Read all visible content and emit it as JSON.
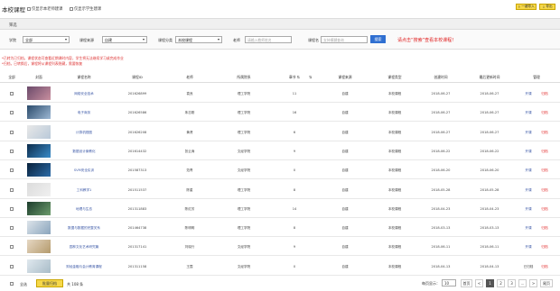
{
  "header": {
    "title": "本校课程",
    "options": [
      "仅显示本老师建课",
      "仅显示学生建课"
    ],
    "import_label": "一键导入",
    "export_label": "导出"
  },
  "filter": {
    "panel_title": "筛选",
    "school_label": "学院",
    "school_value": "全部",
    "source_label": "课程来源",
    "source_value": "自建",
    "category_label": "课程分类",
    "category_value": "本校课程",
    "teacher_label": "老师",
    "teacher_placeholder": "请输入教师姓名",
    "course_label": "课程名",
    "course_placeholder": "支持模糊查询",
    "search_label": "搜索",
    "hint": "请点击“搜索”查看本校课程！"
  },
  "notices": [
    "*已转为已归档，课程状态可查看近期课时内容，学生将无法继续学习或完成作业",
    "*归档，已转换后，课程将从课程列表隐藏，需要恢复"
  ],
  "table": {
    "columns": [
      "全部",
      "封面",
      "课程名称",
      "课程ID",
      "老师",
      "所属院系",
      "章节",
      "人数",
      "课程来源",
      "课程类型",
      "创建时间",
      "最后更新时间",
      "管理"
    ],
    "rows": [
      {
        "name": "网络安全技术",
        "id": "201626899",
        "teacher": "袁良",
        "dept": "理工学院",
        "chapters": "11",
        "source": "自建",
        "type": "本校课程",
        "created": "2018-06-27",
        "updated": "2018-06-27",
        "action1": "开课",
        "action2": "归档",
        "cover": [
          "#6a4a6a",
          "#c98f9f"
        ]
      },
      {
        "name": "电子商务",
        "id": "201626586",
        "teacher": "朱志刚",
        "dept": "理工学院",
        "chapters": "16",
        "source": "自建",
        "type": "本校课程",
        "created": "2018-06-27",
        "updated": "2018-06-27",
        "action1": "开课",
        "action2": "归档",
        "cover": [
          "#2a4a6a",
          "#9db8d4"
        ]
      },
      {
        "name": "计算机视图",
        "id": "201626208",
        "teacher": "黄贤",
        "dept": "理工学院",
        "chapters": "6",
        "source": "自建",
        "type": "本校课程",
        "created": "2018-06-27",
        "updated": "2018-06-27",
        "action1": "开课",
        "action2": "归档",
        "cover": [
          "#e8e8e8",
          "#b9c9d9"
        ]
      },
      {
        "name": "数据设计案教化",
        "id": "201614432",
        "teacher": "张云涛",
        "dept": "文经学院",
        "chapters": "9",
        "source": "自建",
        "type": "本校课程",
        "created": "2018-06-22",
        "updated": "2018-06-22",
        "action1": "开课",
        "action2": "归档",
        "cover": [
          "#0c2c4c",
          "#3a8bc8"
        ]
      },
      {
        "name": "SVM安全实训",
        "id": "201587313",
        "teacher": "范青",
        "dept": "文经学院",
        "chapters": "0",
        "source": "自建",
        "type": "本校课程",
        "created": "2018-06-20",
        "updated": "2018-06-20",
        "action1": "开课",
        "action2": "归档",
        "cover": [
          "#08203a",
          "#2c6ca8"
        ]
      },
      {
        "name": "工科教学1",
        "id": "201511537",
        "teacher": "陈星",
        "dept": "理工学院",
        "chapters": "8",
        "source": "自建",
        "type": "本校课程",
        "created": "2018-05-28",
        "updated": "2018-05-28",
        "action1": "开课",
        "action2": "归档",
        "cover": [
          "#dcdcdc",
          "#f0f0f0"
        ]
      },
      {
        "name": "地理与生态",
        "id": "201311883",
        "teacher": "陈红芳",
        "dept": "理工学院",
        "chapters": "14",
        "source": "自建",
        "type": "本校课程",
        "created": "2018-04-23",
        "updated": "2018-04-23",
        "action1": "开课",
        "action2": "归档",
        "cover": [
          "#1c3c2c",
          "#6c9c6c"
        ]
      },
      {
        "name": "数据与数据的完整关系",
        "id": "201464738",
        "teacher": "陈明明",
        "dept": "理工学院",
        "chapters": "8",
        "source": "自建",
        "type": "本校课程",
        "created": "2018-03-13",
        "updated": "2018-03-13",
        "action1": "开课",
        "action2": "归档",
        "cover": [
          "#dde4ea",
          "#8aa4bc"
        ]
      },
      {
        "name": "园林文化艺术研究篇",
        "id": "201317141",
        "teacher": "刘晓行",
        "dept": "文经学院",
        "chapters": "9",
        "source": "自建",
        "type": "本校课程",
        "created": "2018-06-11",
        "updated": "2018-06-11",
        "action1": "开课",
        "action2": "归档",
        "cover": [
          "#e6d8c4",
          "#b49a6c"
        ]
      },
      {
        "name": "财经金融与会计教育课程",
        "id": "201311158",
        "teacher": "王霞",
        "dept": "文经学院",
        "chapters": "0",
        "source": "自建",
        "type": "本校课程",
        "created": "2018-04-13",
        "updated": "2018-04-13",
        "action1": "已归档",
        "action2": "归档",
        "cover": [
          "#e0e8ee",
          "#a8bcc8"
        ]
      }
    ]
  },
  "footer": {
    "select_all": "全选",
    "batch_label": "批量归档",
    "total": "共 108 条",
    "per_page_label": "每页显示：",
    "per_page_value": "10",
    "first": "首页",
    "prev": "<",
    "pages": [
      "1",
      "2",
      "3",
      "..."
    ],
    "next": ">",
    "last": "尾页"
  },
  "colors": {
    "accent_yellow": "#f6d84a",
    "search_blue": "#2f6fd1",
    "warning_red": "#e02020",
    "link_blue": "#3a57a6"
  }
}
